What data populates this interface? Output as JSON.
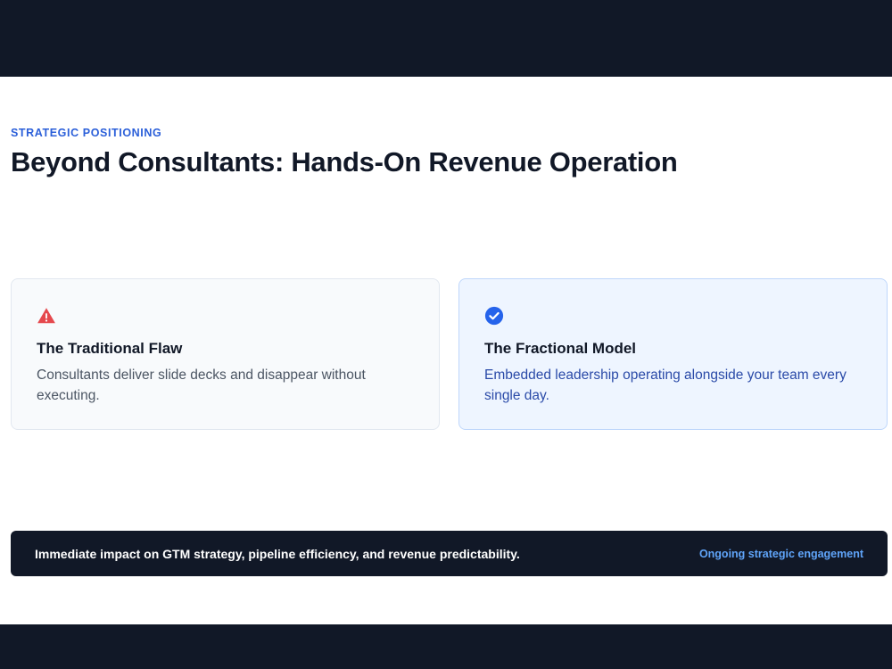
{
  "section": {
    "eyebrow": "STRATEGIC POSITIONING",
    "headline": "Beyond Consultants: Hands-On Revenue Operation"
  },
  "cards": [
    {
      "icon": "warning-icon",
      "icon_color": "#e5484d",
      "title": "The Traditional Flaw",
      "description": "Consultants deliver slide decks and disappear without executing."
    },
    {
      "icon": "check-circle-icon",
      "icon_color": "#2563eb",
      "title": "The Fractional Model",
      "description": "Embedded leadership operating alongside your team every single day."
    }
  ],
  "banner": {
    "text": "Immediate impact on GTM strategy, pipeline efficiency, and revenue predictability.",
    "link": "Ongoing strategic engagement"
  },
  "colors": {
    "dark": "#111827",
    "accent": "#2b5fd9",
    "link": "#60a5fa"
  }
}
